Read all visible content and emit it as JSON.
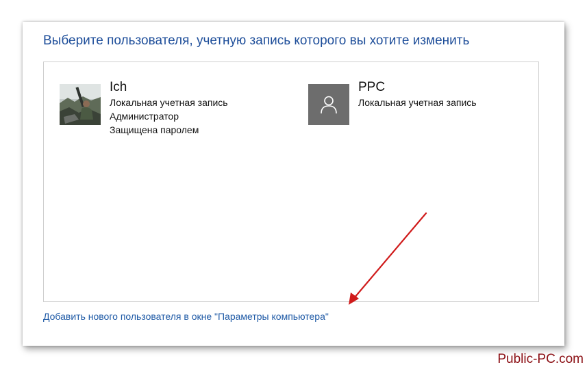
{
  "dialog": {
    "heading": "Выберите пользователя, учетную запись которого вы хотите изменить",
    "accounts": [
      {
        "name": "Ich",
        "details": [
          "Локальная учетная запись",
          "Администратор",
          "Защищена паролем"
        ],
        "avatar": "user-photo"
      },
      {
        "name": "PPC",
        "details": [
          "Локальная учетная запись"
        ],
        "avatar": "person-icon"
      }
    ],
    "add_user_link": "Добавить нового пользователя в окне \"Параметры компьютера\""
  },
  "annotation": {
    "arrow_color": "#d01b1b",
    "arrow_target": "add_user_link"
  },
  "watermark": "Public-PC.com",
  "colors": {
    "heading": "#1e4e9a",
    "link": "#1f5aa6",
    "default_avatar_bg": "#6d6d6d",
    "watermark": "#8b0f14"
  }
}
